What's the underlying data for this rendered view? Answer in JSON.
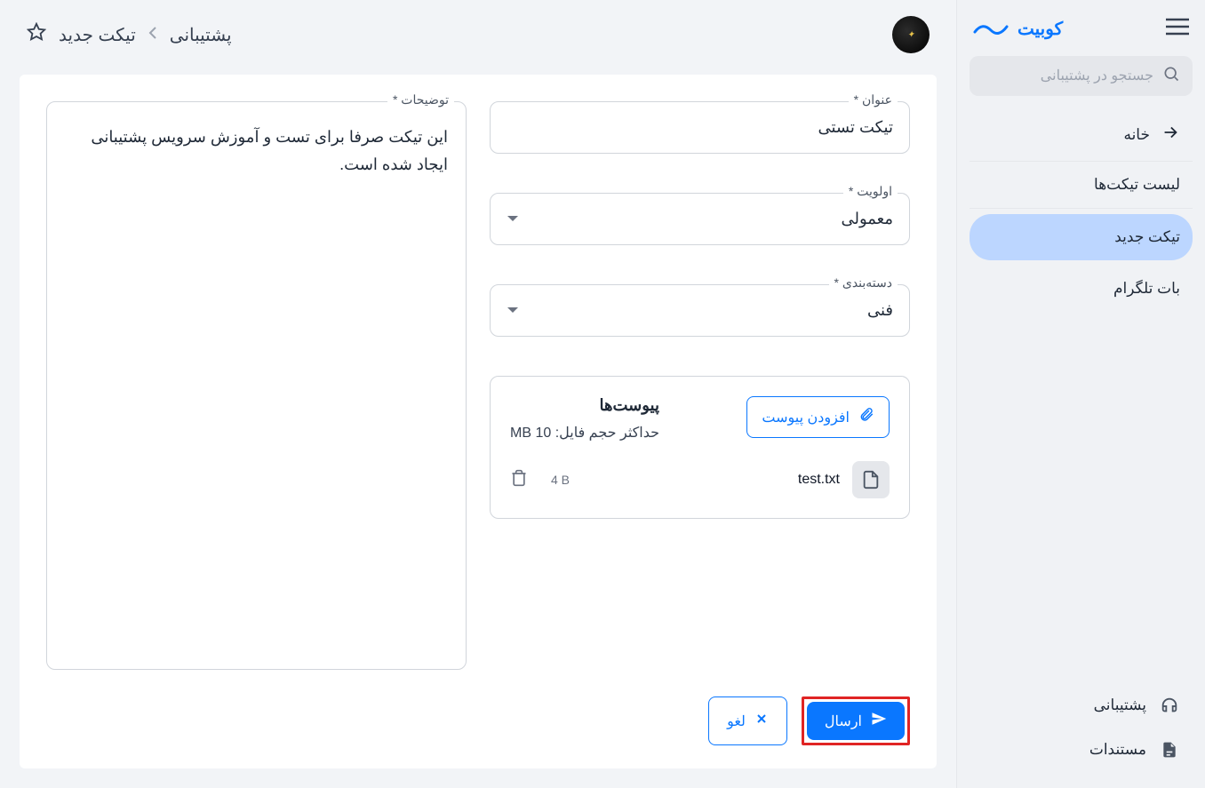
{
  "brand": {
    "name": "کوبیت"
  },
  "search": {
    "placeholder": "جستجو در پشتیبانی"
  },
  "nav": {
    "home": "خانه",
    "tickets": "لیست تیکت‌ها",
    "new_ticket": "تیکت جدید",
    "bot": "بات تلگرام"
  },
  "footer": {
    "support": "پشتیبانی",
    "docs": "مستندات"
  },
  "breadcrumb": {
    "root": "پشتیبانی",
    "current": "تیکت جدید"
  },
  "form": {
    "title_label": "عنوان *",
    "title_value": "تیکت تستی",
    "priority_label": "اولویت *",
    "priority_value": "معمولی",
    "category_label": "دسته‌بندی *",
    "category_value": "فنی",
    "desc_label": "توضیحات *",
    "desc_value": "این تیکت صرفا برای تست و آموزش سرویس پشتیبانی ایجاد شده است."
  },
  "attachments": {
    "title": "پیوست‌ها",
    "max_label": "حداکثر حجم فایل: 10 MB",
    "add_button": "افزودن پیوست",
    "file_name": "test.txt",
    "file_size": "4 B"
  },
  "actions": {
    "submit": "ارسال",
    "cancel": "لغو"
  }
}
